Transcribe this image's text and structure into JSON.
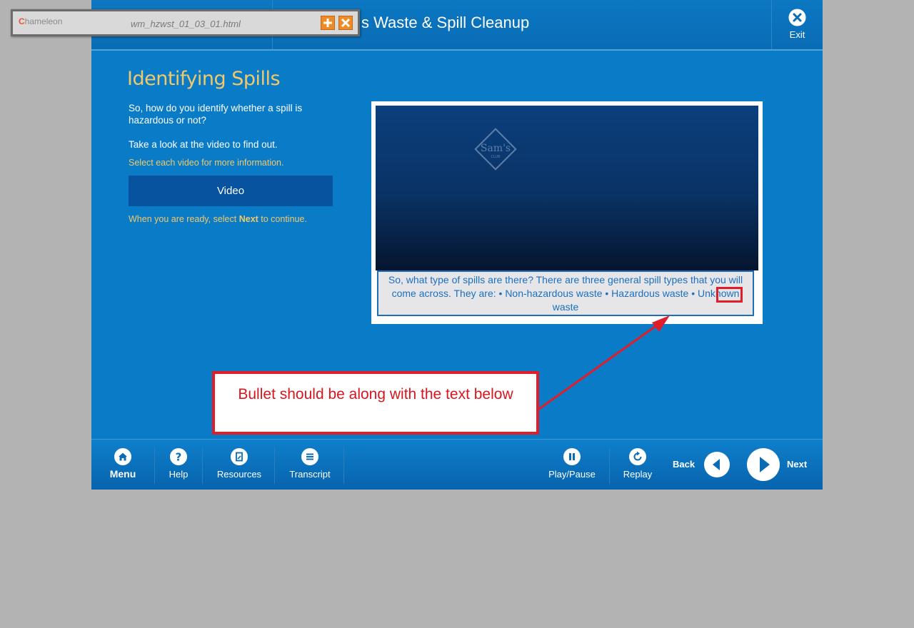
{
  "popup": {
    "logo_initial": "C",
    "logo_text": "hameleon",
    "filename": "wm_hzwst_01_03_01.html",
    "add_icon": "plus-icon",
    "close_icon": "close-icon"
  },
  "header": {
    "title": "s Waste & Spill Cleanup",
    "exit_label": "Exit"
  },
  "content": {
    "title": "Identifying Spills",
    "intro_question": "So, how do you identify whether a spill is hazardous or not?",
    "intro_video": "Take a look at the video to find out.",
    "hint_select": "Select each video for more information.",
    "video_button": "Video",
    "hint_next_before": "When you are ready, select ",
    "hint_next_bold": "Next",
    "hint_next_after": " to continue."
  },
  "video": {
    "logo_text": "Sam's",
    "logo_subtext": "CLUB",
    "caption": "So, what type of spills are there?  There are three general spill types that you will come across.  They are:  • Non-hazardous waste  • Hazardous waste  • Unknown waste"
  },
  "annotation": {
    "callout_text": "Bullet should be along with the text below"
  },
  "footer": {
    "menu_label": "Menu",
    "help_label": "Help",
    "resources_label": "Resources",
    "transcript_label": "Transcript",
    "playpause_label": "Play/Pause",
    "replay_label": "Replay",
    "back_label": "Back",
    "next_label": "Next"
  },
  "colors": {
    "accent": "#f2c86a",
    "primary": "#0a7bc6",
    "annotation": "#e01e2a"
  }
}
